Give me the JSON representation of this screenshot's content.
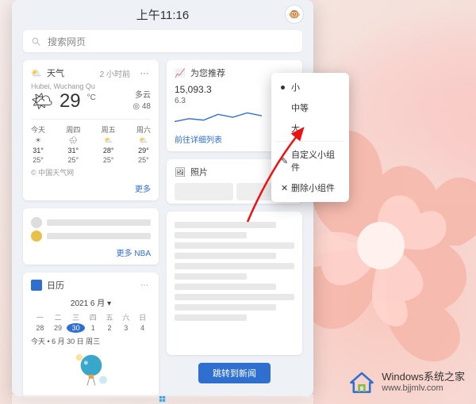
{
  "clock": "上午11:16",
  "search_placeholder": "搜索网页",
  "avatar_emoji": "🐵",
  "weather": {
    "title": "天气",
    "updated": "2 小时前",
    "location": "Hubei, Wuchang Qu",
    "temp": "29",
    "unit": "°C",
    "cond": "多云",
    "aqi": "◎ 48",
    "days": [
      {
        "label": "今天",
        "icon": "☀",
        "hi": "31°",
        "lo": "25°"
      },
      {
        "label": "周四",
        "icon": "🌧",
        "hi": "31°",
        "lo": "25°"
      },
      {
        "label": "周五",
        "icon": "⛅",
        "hi": "28°",
        "lo": "25°"
      },
      {
        "label": "周六",
        "icon": "⛅",
        "hi": "29°",
        "lo": "25°"
      }
    ],
    "source": "© 中国天气网",
    "more": "更多"
  },
  "sports": {
    "more": "更多 NBA"
  },
  "calendar": {
    "title": "日历",
    "month": "2021 6 月",
    "dow": [
      "一",
      "二",
      "三",
      "四",
      "五",
      "六",
      "日"
    ],
    "row": [
      "28",
      "29",
      "30",
      "1",
      "2",
      "3",
      "4"
    ],
    "today_idx": 2,
    "today_line": "今天 • 6 月 30 日 周三"
  },
  "recommend": {
    "title": "为您推荐",
    "value": "15,093.3",
    "delta": "6.3",
    "link": "前往详细列表"
  },
  "photos": {
    "title": "照片"
  },
  "goto_news": "跳转到新闻",
  "context_menu": {
    "small": "小",
    "medium": "中等",
    "large": "大",
    "customize": "自定义小组件",
    "remove": "删除小组件"
  },
  "watermark": {
    "line1": "Windows系统之家",
    "line2": "www.bjjmlv.com"
  }
}
